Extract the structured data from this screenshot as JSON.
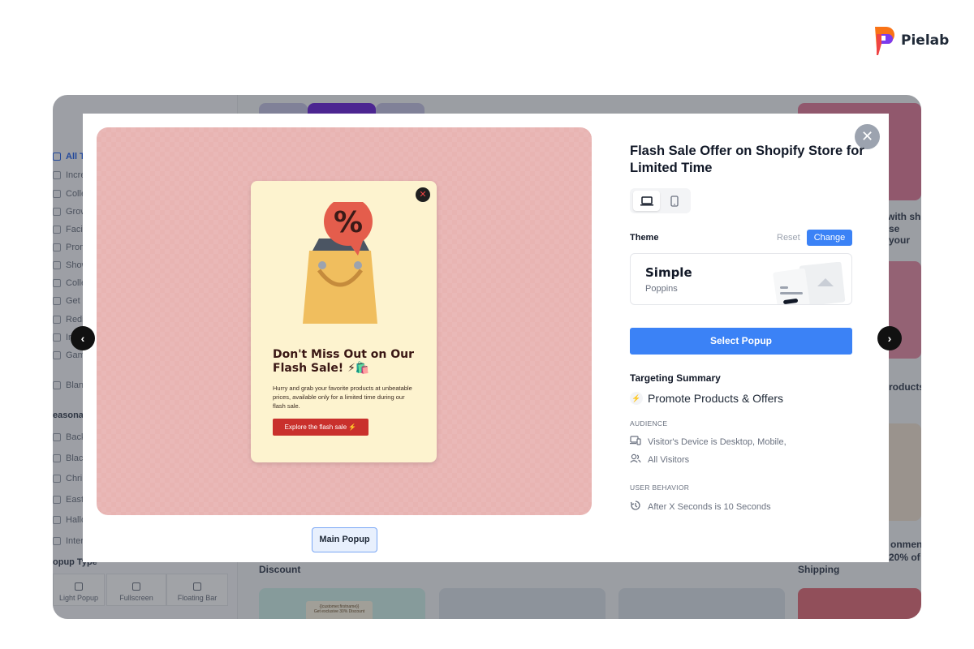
{
  "brand": {
    "name": "Pielab"
  },
  "background": {
    "sidebar_items": [
      "All T",
      "Incre",
      "Colle",
      "Grow",
      "Facil",
      "Prom",
      "Show",
      "Colle",
      "Get",
      "Redi",
      "Ir",
      "Gam"
    ],
    "blank_item": "Blan",
    "seasonal_heading": "easonal",
    "seasonal_items": [
      "Back",
      "Blac",
      "Chri",
      "East",
      "Hallo",
      "Inter"
    ],
    "popup_type_heading": "opup Type",
    "popup_types": [
      "Light Popup",
      "Fullscreen",
      "Floating Bar"
    ],
    "section_discount": "Discount",
    "section_shipping": "Shipping",
    "right_text_1": "with sh",
    "right_text_2": "se your",
    "right_text_3": "roducts",
    "right_text_4": "onmen",
    "right_text_5": "20% of",
    "card_snippet_1": "{{customer.firstname}}",
    "card_snippet_2": "Get exclusive 30% Discount"
  },
  "preview": {
    "popup_title": "Don't Miss Out on Our Flash Sale! ⚡🛍️",
    "popup_body": "Hurry and grab your favorite products at unbeatable prices, available only for a limited time during our flash sale.",
    "popup_cta": "Explore the flash sale ⚡",
    "tab_label": "Main Popup"
  },
  "panel": {
    "title": "Flash Sale Offer on Shopify Store for Limited Time",
    "theme_label": "Theme",
    "reset_label": "Reset",
    "change_label": "Change",
    "theme_name": "Simple",
    "theme_font": "Poppins",
    "select_label": "Select Popup",
    "targeting_title": "Targeting Summary",
    "goal": "Promote Products & Offers",
    "audience_caption": "AUDIENCE",
    "audience_device": "Visitor's Device is Desktop, Mobile,",
    "audience_visitors": "All Visitors",
    "behavior_caption": "USER BEHAVIOR",
    "behavior_timing": "After X Seconds is 10 Seconds"
  },
  "colors": {
    "accent": "#3b82f6",
    "preview_bg": "#e8b4b2",
    "popup_bg": "#fdf3cf",
    "cta": "#c9302c"
  },
  "icons": [
    "pielab-logo",
    "close-icon",
    "chevron-left-icon",
    "chevron-right-icon",
    "desktop-icon",
    "mobile-icon",
    "bolt-icon",
    "device-icon",
    "users-icon",
    "timer-icon",
    "shopping-bag-icon"
  ]
}
